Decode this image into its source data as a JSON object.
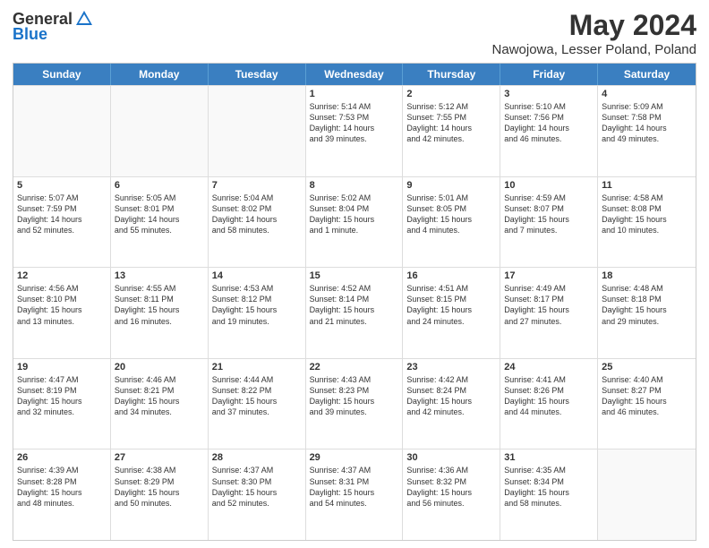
{
  "logo": {
    "general": "General",
    "blue": "Blue"
  },
  "title": "May 2024",
  "subtitle": "Nawojowa, Lesser Poland, Poland",
  "header_days": [
    "Sunday",
    "Monday",
    "Tuesday",
    "Wednesday",
    "Thursday",
    "Friday",
    "Saturday"
  ],
  "weeks": [
    [
      {
        "day": "",
        "info": ""
      },
      {
        "day": "",
        "info": ""
      },
      {
        "day": "",
        "info": ""
      },
      {
        "day": "1",
        "info": "Sunrise: 5:14 AM\nSunset: 7:53 PM\nDaylight: 14 hours\nand 39 minutes."
      },
      {
        "day": "2",
        "info": "Sunrise: 5:12 AM\nSunset: 7:55 PM\nDaylight: 14 hours\nand 42 minutes."
      },
      {
        "day": "3",
        "info": "Sunrise: 5:10 AM\nSunset: 7:56 PM\nDaylight: 14 hours\nand 46 minutes."
      },
      {
        "day": "4",
        "info": "Sunrise: 5:09 AM\nSunset: 7:58 PM\nDaylight: 14 hours\nand 49 minutes."
      }
    ],
    [
      {
        "day": "5",
        "info": "Sunrise: 5:07 AM\nSunset: 7:59 PM\nDaylight: 14 hours\nand 52 minutes."
      },
      {
        "day": "6",
        "info": "Sunrise: 5:05 AM\nSunset: 8:01 PM\nDaylight: 14 hours\nand 55 minutes."
      },
      {
        "day": "7",
        "info": "Sunrise: 5:04 AM\nSunset: 8:02 PM\nDaylight: 14 hours\nand 58 minutes."
      },
      {
        "day": "8",
        "info": "Sunrise: 5:02 AM\nSunset: 8:04 PM\nDaylight: 15 hours\nand 1 minute."
      },
      {
        "day": "9",
        "info": "Sunrise: 5:01 AM\nSunset: 8:05 PM\nDaylight: 15 hours\nand 4 minutes."
      },
      {
        "day": "10",
        "info": "Sunrise: 4:59 AM\nSunset: 8:07 PM\nDaylight: 15 hours\nand 7 minutes."
      },
      {
        "day": "11",
        "info": "Sunrise: 4:58 AM\nSunset: 8:08 PM\nDaylight: 15 hours\nand 10 minutes."
      }
    ],
    [
      {
        "day": "12",
        "info": "Sunrise: 4:56 AM\nSunset: 8:10 PM\nDaylight: 15 hours\nand 13 minutes."
      },
      {
        "day": "13",
        "info": "Sunrise: 4:55 AM\nSunset: 8:11 PM\nDaylight: 15 hours\nand 16 minutes."
      },
      {
        "day": "14",
        "info": "Sunrise: 4:53 AM\nSunset: 8:12 PM\nDaylight: 15 hours\nand 19 minutes."
      },
      {
        "day": "15",
        "info": "Sunrise: 4:52 AM\nSunset: 8:14 PM\nDaylight: 15 hours\nand 21 minutes."
      },
      {
        "day": "16",
        "info": "Sunrise: 4:51 AM\nSunset: 8:15 PM\nDaylight: 15 hours\nand 24 minutes."
      },
      {
        "day": "17",
        "info": "Sunrise: 4:49 AM\nSunset: 8:17 PM\nDaylight: 15 hours\nand 27 minutes."
      },
      {
        "day": "18",
        "info": "Sunrise: 4:48 AM\nSunset: 8:18 PM\nDaylight: 15 hours\nand 29 minutes."
      }
    ],
    [
      {
        "day": "19",
        "info": "Sunrise: 4:47 AM\nSunset: 8:19 PM\nDaylight: 15 hours\nand 32 minutes."
      },
      {
        "day": "20",
        "info": "Sunrise: 4:46 AM\nSunset: 8:21 PM\nDaylight: 15 hours\nand 34 minutes."
      },
      {
        "day": "21",
        "info": "Sunrise: 4:44 AM\nSunset: 8:22 PM\nDaylight: 15 hours\nand 37 minutes."
      },
      {
        "day": "22",
        "info": "Sunrise: 4:43 AM\nSunset: 8:23 PM\nDaylight: 15 hours\nand 39 minutes."
      },
      {
        "day": "23",
        "info": "Sunrise: 4:42 AM\nSunset: 8:24 PM\nDaylight: 15 hours\nand 42 minutes."
      },
      {
        "day": "24",
        "info": "Sunrise: 4:41 AM\nSunset: 8:26 PM\nDaylight: 15 hours\nand 44 minutes."
      },
      {
        "day": "25",
        "info": "Sunrise: 4:40 AM\nSunset: 8:27 PM\nDaylight: 15 hours\nand 46 minutes."
      }
    ],
    [
      {
        "day": "26",
        "info": "Sunrise: 4:39 AM\nSunset: 8:28 PM\nDaylight: 15 hours\nand 48 minutes."
      },
      {
        "day": "27",
        "info": "Sunrise: 4:38 AM\nSunset: 8:29 PM\nDaylight: 15 hours\nand 50 minutes."
      },
      {
        "day": "28",
        "info": "Sunrise: 4:37 AM\nSunset: 8:30 PM\nDaylight: 15 hours\nand 52 minutes."
      },
      {
        "day": "29",
        "info": "Sunrise: 4:37 AM\nSunset: 8:31 PM\nDaylight: 15 hours\nand 54 minutes."
      },
      {
        "day": "30",
        "info": "Sunrise: 4:36 AM\nSunset: 8:32 PM\nDaylight: 15 hours\nand 56 minutes."
      },
      {
        "day": "31",
        "info": "Sunrise: 4:35 AM\nSunset: 8:34 PM\nDaylight: 15 hours\nand 58 minutes."
      },
      {
        "day": "",
        "info": ""
      }
    ]
  ]
}
